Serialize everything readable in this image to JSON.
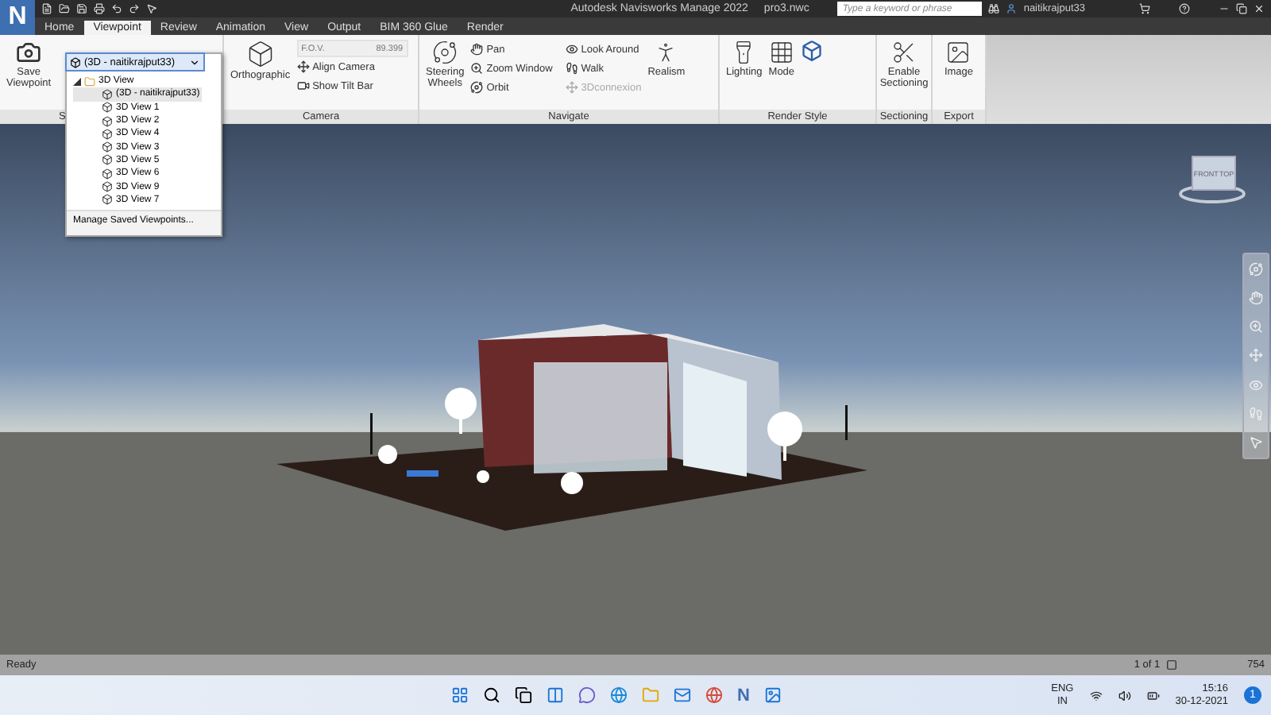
{
  "title_bar": {
    "app_logo": "N",
    "title": "Autodesk Navisworks Manage 2022",
    "file_name": "pro3.nwc",
    "search": {
      "placeholder": "Type a keyword or phrase"
    },
    "user": "naitikrajput33"
  },
  "tabs": [
    {
      "label": "Home",
      "selected": false
    },
    {
      "label": "Viewpoint",
      "selected": true
    },
    {
      "label": "Review",
      "selected": false
    },
    {
      "label": "Animation",
      "selected": false
    },
    {
      "label": "View",
      "selected": false
    },
    {
      "label": "Output",
      "selected": false
    },
    {
      "label": "BIM 360 Glue",
      "selected": false
    },
    {
      "label": "Render",
      "selected": false
    }
  ],
  "ribbon": {
    "viewpoint_group": {
      "label": "S",
      "save_button": "Save\nViewpoint"
    },
    "camera_group": {
      "label": "Camera",
      "projection": "Orthographic",
      "fov_label": "F.O.V.",
      "fov_value": "89.399",
      "align_camera": "Align Camera",
      "show_tilt_bar": "Show Tilt Bar"
    },
    "navigate_group": {
      "label": "Navigate",
      "steering_wheels": "Steering\nWheels",
      "tools": [
        {
          "label": "Pan",
          "kind": "pan",
          "disabled": false
        },
        {
          "label": "Zoom Window",
          "kind": "zoom",
          "disabled": false
        },
        {
          "label": "Orbit",
          "kind": "orbit",
          "disabled": false
        },
        {
          "label": "Look Around",
          "kind": "look",
          "disabled": false
        },
        {
          "label": "Walk",
          "kind": "walk",
          "disabled": false
        },
        {
          "label": "3Dconnexion",
          "kind": "connexion",
          "disabled": true
        }
      ],
      "realism": "Realism"
    },
    "render_group": {
      "label": "Render Style",
      "lighting": "Lighting",
      "mode": "Mode"
    },
    "sectioning_group": {
      "label": "Sectioning",
      "enable": "Enable\nSectioning"
    },
    "export_group": {
      "label": "Export",
      "image": "Image"
    }
  },
  "viewpoint_dropdown": {
    "value": "(3D - naitikrajput33)",
    "tree": {
      "label": "3D View",
      "expanded": true,
      "children": [
        {
          "label": "(3D - naitikrajput33)",
          "selected": true
        },
        {
          "label": "3D View 1",
          "selected": false
        },
        {
          "label": "3D View 2",
          "selected": false
        },
        {
          "label": "3D View 4",
          "selected": false
        },
        {
          "label": "3D View 3",
          "selected": false
        },
        {
          "label": "3D View 5",
          "selected": false
        },
        {
          "label": "3D View 6",
          "selected": false
        },
        {
          "label": "3D View 9",
          "selected": false
        },
        {
          "label": "3D View 7",
          "selected": false
        }
      ]
    },
    "footer": "Manage Saved Viewpoints..."
  },
  "view_cube": {
    "front": "FRONT",
    "side": "TOP"
  },
  "status_bar": {
    "message": "Ready",
    "page": "1 of 1",
    "memory": "754"
  },
  "taskbar": {
    "app_icon": "N",
    "language": "ENG",
    "region": "IN",
    "time": "15:16",
    "date": "30-12-2021",
    "notifications": "1"
  }
}
